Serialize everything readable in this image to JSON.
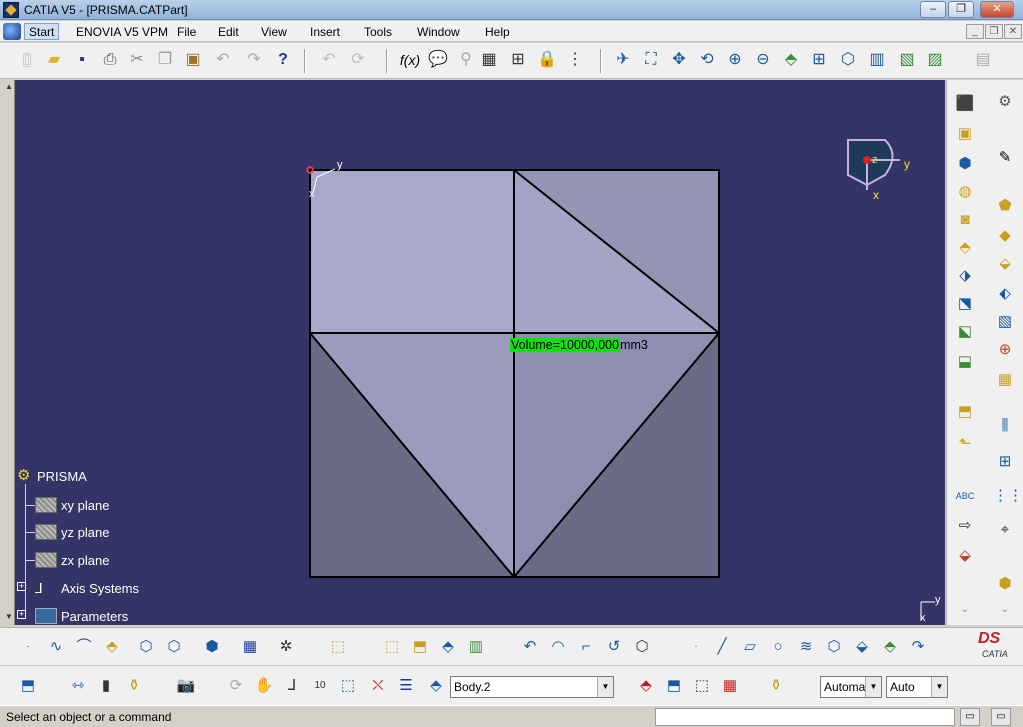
{
  "window": {
    "title": "CATIA V5 - [PRISMA.CATPart]",
    "min_label": "–",
    "max_label": "❐",
    "close_label": "✕"
  },
  "menu": {
    "items": [
      "Start",
      "ENOVIA V5 VPM",
      "File",
      "Edit",
      "View",
      "Insert",
      "Tools",
      "Window",
      "Help"
    ]
  },
  "tree": {
    "root": "PRISMA",
    "items": [
      "xy plane",
      "yz plane",
      "zx plane",
      "Axis Systems",
      "Parameters"
    ]
  },
  "measure": {
    "value": "Volume=10000,000",
    "unit": "mm3"
  },
  "compass": {
    "x": "x",
    "y": "y",
    "z": "z"
  },
  "axis_marker": {
    "x": "x",
    "y": "y"
  },
  "part_combo": {
    "value": "Body.2"
  },
  "auto_combo1": {
    "value": "Automa"
  },
  "auto_combo2": {
    "value": "Auto"
  },
  "logo": {
    "text": "CATIA"
  },
  "status": {
    "text": "Select an object or a command"
  },
  "colors": {
    "viewport": "#353466",
    "face_light": "#a8a8cc",
    "face_mid": "#9494b4",
    "face_dark": "#6b6b88",
    "highlight": "#10e010"
  }
}
